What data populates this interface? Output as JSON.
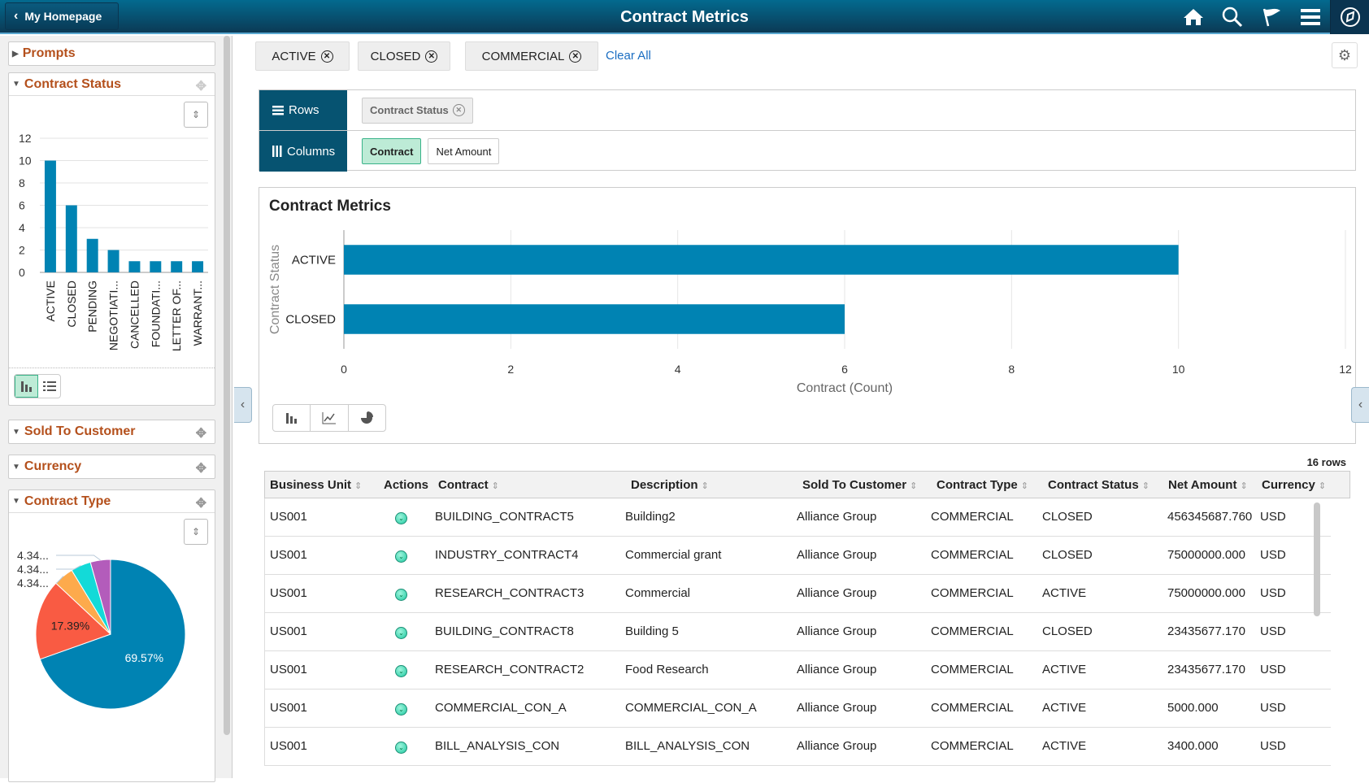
{
  "header": {
    "back_label": "My Homepage",
    "title": "Contract Metrics",
    "icons": [
      "home-icon",
      "search-icon",
      "flag-icon",
      "menu-icon",
      "navbar-icon"
    ]
  },
  "sidebar": {
    "prompts_label": "Prompts",
    "facets": [
      {
        "label": "Contract Status",
        "expanded": true
      },
      {
        "label": "Sold To Customer",
        "expanded": false
      },
      {
        "label": "Currency",
        "expanded": false
      },
      {
        "label": "Contract Type",
        "expanded": true
      }
    ]
  },
  "filters": {
    "chips": [
      "ACTIVE",
      "CLOSED",
      "COMMERCIAL"
    ],
    "clear_all": "Clear All"
  },
  "pivot": {
    "rows_label": "Rows",
    "columns_label": "Columns",
    "row_chips": [
      "Contract Status"
    ],
    "column_chips": [
      "Contract",
      "Net Amount"
    ]
  },
  "main_chart_title": "Contract Metrics",
  "chart_data": [
    {
      "type": "bar",
      "orientation": "vertical",
      "title": "Contract Status",
      "categories": [
        "ACTIVE",
        "CLOSED",
        "PENDING",
        "NEGOTIATI...",
        "CANCELLED",
        "FOUNDATI...",
        "LETTER OF...",
        "WARRANT..."
      ],
      "values": [
        10,
        6,
        3,
        2,
        1,
        1,
        1,
        1
      ],
      "ylim": [
        0,
        12
      ],
      "yticks": [
        0,
        2,
        4,
        6,
        8,
        10,
        12
      ],
      "color": "#0083b3",
      "grid": true
    },
    {
      "type": "pie",
      "title": "Contract Type",
      "slices": [
        {
          "label": "69.57%",
          "value": 69.57,
          "color": "#0083b3"
        },
        {
          "label": "17.39%",
          "value": 17.39,
          "color": "#f95b43"
        },
        {
          "label": "4.34...",
          "value": 4.348,
          "color": "#fdaa4c"
        },
        {
          "label": "4.34...",
          "value": 4.348,
          "color": "#13dad8"
        },
        {
          "label": "4.34...",
          "value": 4.348,
          "color": "#b35cbb"
        }
      ]
    },
    {
      "type": "bar",
      "orientation": "horizontal",
      "title": "Contract Metrics",
      "categories": [
        "ACTIVE",
        "CLOSED"
      ],
      "values": [
        10,
        6
      ],
      "xlabel": "Contract (Count)",
      "ylabel": "Contract Status",
      "xlim": [
        0,
        12
      ],
      "xticks": [
        0,
        2,
        4,
        6,
        8,
        10,
        12
      ],
      "color": "#0083b3",
      "grid": true
    }
  ],
  "grid": {
    "row_count": "16 rows",
    "columns": [
      "Business Unit",
      "Actions",
      "Contract",
      "Description",
      "Sold To Customer",
      "Contract Type",
      "Contract Status",
      "Net Amount",
      "Currency"
    ],
    "rows": [
      [
        "US001",
        "",
        "BUILDING_CONTRACT5",
        "Building2",
        "Alliance Group",
        "COMMERCIAL",
        "CLOSED",
        "456345687.760",
        "USD"
      ],
      [
        "US001",
        "",
        "INDUSTRY_CONTRACT4",
        "Commercial grant",
        "Alliance Group",
        "COMMERCIAL",
        "CLOSED",
        "75000000.000",
        "USD"
      ],
      [
        "US001",
        "",
        "RESEARCH_CONTRACT3",
        "Commercial",
        "Alliance Group",
        "COMMERCIAL",
        "ACTIVE",
        "75000000.000",
        "USD"
      ],
      [
        "US001",
        "",
        "BUILDING_CONTRACT8",
        "Building 5",
        "Alliance Group",
        "COMMERCIAL",
        "CLOSED",
        "23435677.170",
        "USD"
      ],
      [
        "US001",
        "",
        "RESEARCH_CONTRACT2",
        "Food Research",
        "Alliance Group",
        "COMMERCIAL",
        "ACTIVE",
        "23435677.170",
        "USD"
      ],
      [
        "US001",
        "",
        "COMMERCIAL_CON_A",
        "COMMERCIAL_CON_A",
        "Alliance Group",
        "COMMERCIAL",
        "ACTIVE",
        "5000.000",
        "USD"
      ],
      [
        "US001",
        "",
        "BILL_ANALYSIS_CON",
        "BILL_ANALYSIS_CON",
        "Alliance Group",
        "COMMERCIAL",
        "ACTIVE",
        "3400.000",
        "USD"
      ]
    ]
  }
}
